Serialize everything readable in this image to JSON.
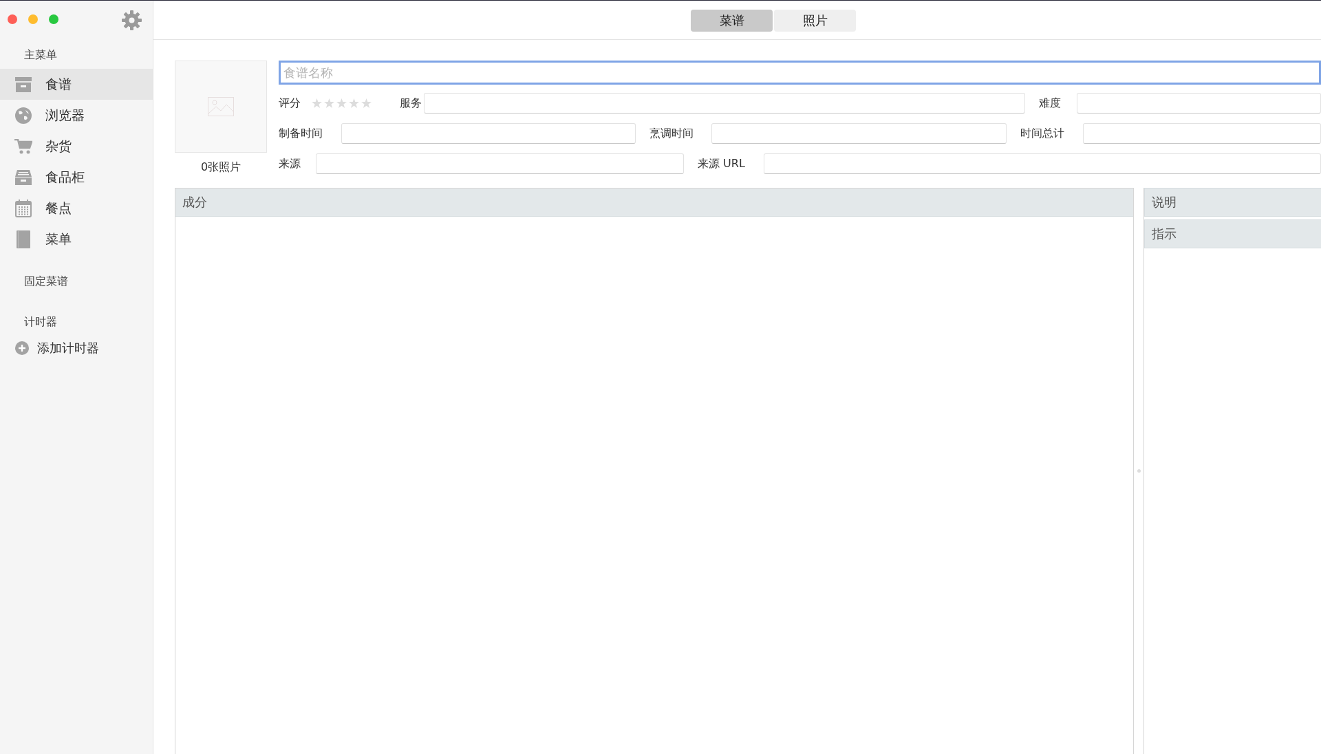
{
  "window": {
    "controls": [
      {
        "kind": "close"
      },
      {
        "kind": "minimize"
      },
      {
        "kind": "zoom"
      }
    ]
  },
  "sidebar": {
    "sections": [
      {
        "title": "主菜单",
        "items": [
          {
            "label": "食谱",
            "selected": true
          },
          {
            "label": "浏览器",
            "selected": false
          },
          {
            "label": "杂货",
            "selected": false
          },
          {
            "label": "食品柜",
            "selected": false
          },
          {
            "label": "餐点",
            "selected": false
          },
          {
            "label": "菜单",
            "selected": false
          }
        ]
      },
      {
        "title": "固定菜谱"
      },
      {
        "title": "计时器",
        "actions": [
          {
            "label": "添加计时器"
          }
        ]
      }
    ]
  },
  "tabs": [
    {
      "label": "菜谱",
      "selected": true
    },
    {
      "label": "照片",
      "selected": false
    }
  ],
  "photo": {
    "caption": "0张照片"
  },
  "name_field": {
    "placeholder": "食谱名称",
    "focused": true
  },
  "rows": [
    [
      {
        "kind": "rating",
        "label": "评分",
        "stars": 0
      },
      {
        "kind": "field",
        "label": "服务"
      },
      {
        "kind": "field",
        "label": "难度"
      }
    ],
    [
      {
        "kind": "field",
        "label": "制备时间"
      },
      {
        "kind": "field",
        "label": "烹调时间"
      },
      {
        "kind": "field",
        "label": "时间总计"
      }
    ],
    [
      {
        "kind": "field",
        "label": "来源"
      },
      {
        "kind": "field",
        "label": "来源 URL"
      }
    ]
  ],
  "ingredients": {
    "title": "成分"
  },
  "side_panels": [
    {
      "title": "说明"
    },
    {
      "title": "指示"
    }
  ]
}
